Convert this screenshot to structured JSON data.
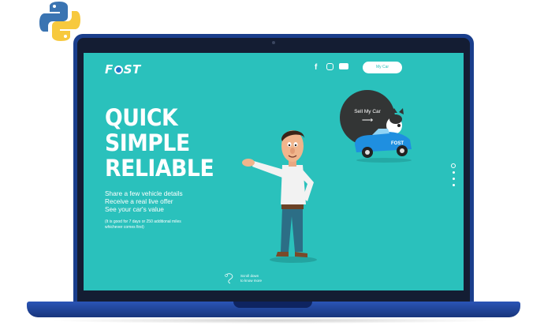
{
  "branding": {
    "logo_text_left": "F",
    "logo_text_right": "ST"
  },
  "nav": {
    "social": [
      {
        "icon": "facebook-icon",
        "glyph": "f"
      },
      {
        "icon": "instagram-icon",
        "glyph": ""
      },
      {
        "icon": "youtube-icon",
        "glyph": ""
      }
    ],
    "my_car_label": "My Car"
  },
  "hero": {
    "headline": [
      "QUICK",
      "SIMPLE",
      "RELIABLE"
    ],
    "points": [
      "Share a few vehicle details",
      "Receive a real live offer",
      "See your car's value"
    ],
    "note": "(It is good for 7 days or 250 additional miles whichever comes first)"
  },
  "cta": {
    "sell_label": "Sell My Car",
    "arrow": "⟶"
  },
  "pager": {
    "count": 4,
    "active_index": 0
  },
  "scroll": {
    "line1": "Scroll down",
    "line2": "to know more"
  },
  "colors": {
    "screen_bg": "#2ac1bc",
    "laptop": "#1a3e8c",
    "cta_circle": "#333535",
    "car": "#1f8fe0"
  }
}
